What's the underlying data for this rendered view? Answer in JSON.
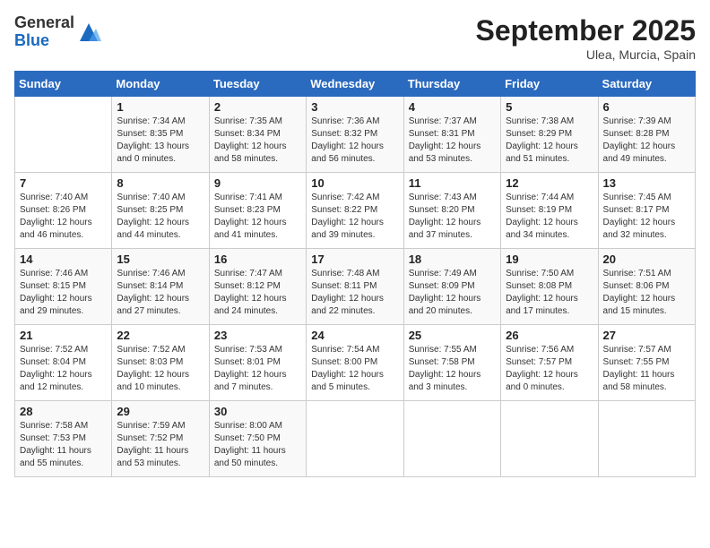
{
  "logo": {
    "general": "General",
    "blue": "Blue"
  },
  "header": {
    "month": "September 2025",
    "location": "Ulea, Murcia, Spain"
  },
  "weekdays": [
    "Sunday",
    "Monday",
    "Tuesday",
    "Wednesday",
    "Thursday",
    "Friday",
    "Saturday"
  ],
  "weeks": [
    [
      {
        "day": "",
        "sunrise": "",
        "sunset": "",
        "daylight": ""
      },
      {
        "day": "1",
        "sunrise": "Sunrise: 7:34 AM",
        "sunset": "Sunset: 8:35 PM",
        "daylight": "Daylight: 13 hours and 0 minutes."
      },
      {
        "day": "2",
        "sunrise": "Sunrise: 7:35 AM",
        "sunset": "Sunset: 8:34 PM",
        "daylight": "Daylight: 12 hours and 58 minutes."
      },
      {
        "day": "3",
        "sunrise": "Sunrise: 7:36 AM",
        "sunset": "Sunset: 8:32 PM",
        "daylight": "Daylight: 12 hours and 56 minutes."
      },
      {
        "day": "4",
        "sunrise": "Sunrise: 7:37 AM",
        "sunset": "Sunset: 8:31 PM",
        "daylight": "Daylight: 12 hours and 53 minutes."
      },
      {
        "day": "5",
        "sunrise": "Sunrise: 7:38 AM",
        "sunset": "Sunset: 8:29 PM",
        "daylight": "Daylight: 12 hours and 51 minutes."
      },
      {
        "day": "6",
        "sunrise": "Sunrise: 7:39 AM",
        "sunset": "Sunset: 8:28 PM",
        "daylight": "Daylight: 12 hours and 49 minutes."
      }
    ],
    [
      {
        "day": "7",
        "sunrise": "Sunrise: 7:40 AM",
        "sunset": "Sunset: 8:26 PM",
        "daylight": "Daylight: 12 hours and 46 minutes."
      },
      {
        "day": "8",
        "sunrise": "Sunrise: 7:40 AM",
        "sunset": "Sunset: 8:25 PM",
        "daylight": "Daylight: 12 hours and 44 minutes."
      },
      {
        "day": "9",
        "sunrise": "Sunrise: 7:41 AM",
        "sunset": "Sunset: 8:23 PM",
        "daylight": "Daylight: 12 hours and 41 minutes."
      },
      {
        "day": "10",
        "sunrise": "Sunrise: 7:42 AM",
        "sunset": "Sunset: 8:22 PM",
        "daylight": "Daylight: 12 hours and 39 minutes."
      },
      {
        "day": "11",
        "sunrise": "Sunrise: 7:43 AM",
        "sunset": "Sunset: 8:20 PM",
        "daylight": "Daylight: 12 hours and 37 minutes."
      },
      {
        "day": "12",
        "sunrise": "Sunrise: 7:44 AM",
        "sunset": "Sunset: 8:19 PM",
        "daylight": "Daylight: 12 hours and 34 minutes."
      },
      {
        "day": "13",
        "sunrise": "Sunrise: 7:45 AM",
        "sunset": "Sunset: 8:17 PM",
        "daylight": "Daylight: 12 hours and 32 minutes."
      }
    ],
    [
      {
        "day": "14",
        "sunrise": "Sunrise: 7:46 AM",
        "sunset": "Sunset: 8:15 PM",
        "daylight": "Daylight: 12 hours and 29 minutes."
      },
      {
        "day": "15",
        "sunrise": "Sunrise: 7:46 AM",
        "sunset": "Sunset: 8:14 PM",
        "daylight": "Daylight: 12 hours and 27 minutes."
      },
      {
        "day": "16",
        "sunrise": "Sunrise: 7:47 AM",
        "sunset": "Sunset: 8:12 PM",
        "daylight": "Daylight: 12 hours and 24 minutes."
      },
      {
        "day": "17",
        "sunrise": "Sunrise: 7:48 AM",
        "sunset": "Sunset: 8:11 PM",
        "daylight": "Daylight: 12 hours and 22 minutes."
      },
      {
        "day": "18",
        "sunrise": "Sunrise: 7:49 AM",
        "sunset": "Sunset: 8:09 PM",
        "daylight": "Daylight: 12 hours and 20 minutes."
      },
      {
        "day": "19",
        "sunrise": "Sunrise: 7:50 AM",
        "sunset": "Sunset: 8:08 PM",
        "daylight": "Daylight: 12 hours and 17 minutes."
      },
      {
        "day": "20",
        "sunrise": "Sunrise: 7:51 AM",
        "sunset": "Sunset: 8:06 PM",
        "daylight": "Daylight: 12 hours and 15 minutes."
      }
    ],
    [
      {
        "day": "21",
        "sunrise": "Sunrise: 7:52 AM",
        "sunset": "Sunset: 8:04 PM",
        "daylight": "Daylight: 12 hours and 12 minutes."
      },
      {
        "day": "22",
        "sunrise": "Sunrise: 7:52 AM",
        "sunset": "Sunset: 8:03 PM",
        "daylight": "Daylight: 12 hours and 10 minutes."
      },
      {
        "day": "23",
        "sunrise": "Sunrise: 7:53 AM",
        "sunset": "Sunset: 8:01 PM",
        "daylight": "Daylight: 12 hours and 7 minutes."
      },
      {
        "day": "24",
        "sunrise": "Sunrise: 7:54 AM",
        "sunset": "Sunset: 8:00 PM",
        "daylight": "Daylight: 12 hours and 5 minutes."
      },
      {
        "day": "25",
        "sunrise": "Sunrise: 7:55 AM",
        "sunset": "Sunset: 7:58 PM",
        "daylight": "Daylight: 12 hours and 3 minutes."
      },
      {
        "day": "26",
        "sunrise": "Sunrise: 7:56 AM",
        "sunset": "Sunset: 7:57 PM",
        "daylight": "Daylight: 12 hours and 0 minutes."
      },
      {
        "day": "27",
        "sunrise": "Sunrise: 7:57 AM",
        "sunset": "Sunset: 7:55 PM",
        "daylight": "Daylight: 11 hours and 58 minutes."
      }
    ],
    [
      {
        "day": "28",
        "sunrise": "Sunrise: 7:58 AM",
        "sunset": "Sunset: 7:53 PM",
        "daylight": "Daylight: 11 hours and 55 minutes."
      },
      {
        "day": "29",
        "sunrise": "Sunrise: 7:59 AM",
        "sunset": "Sunset: 7:52 PM",
        "daylight": "Daylight: 11 hours and 53 minutes."
      },
      {
        "day": "30",
        "sunrise": "Sunrise: 8:00 AM",
        "sunset": "Sunset: 7:50 PM",
        "daylight": "Daylight: 11 hours and 50 minutes."
      },
      {
        "day": "",
        "sunrise": "",
        "sunset": "",
        "daylight": ""
      },
      {
        "day": "",
        "sunrise": "",
        "sunset": "",
        "daylight": ""
      },
      {
        "day": "",
        "sunrise": "",
        "sunset": "",
        "daylight": ""
      },
      {
        "day": "",
        "sunrise": "",
        "sunset": "",
        "daylight": ""
      }
    ]
  ]
}
